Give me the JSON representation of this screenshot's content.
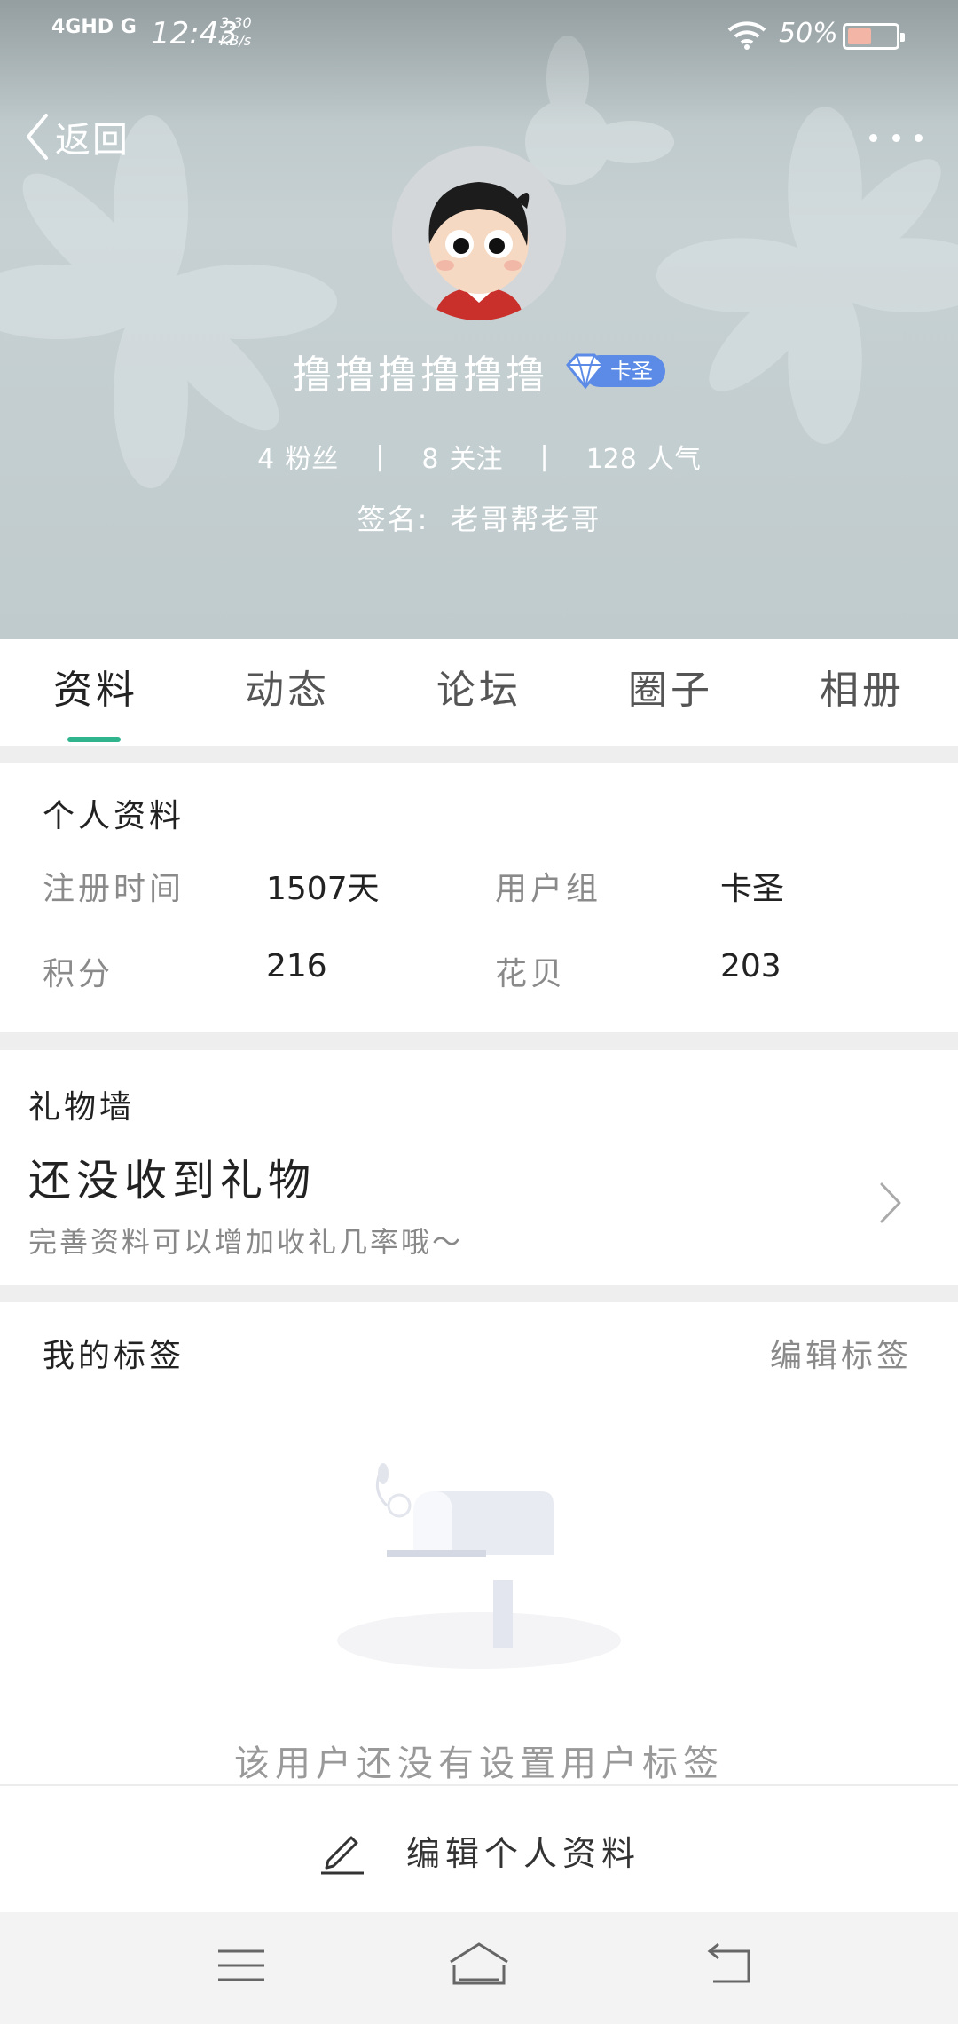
{
  "status_bar": {
    "network": "4GHD G",
    "time": "12:43",
    "speed_value": "3.30",
    "speed_unit": "KB/s",
    "battery_percent": "50%",
    "battery_level": 0.5
  },
  "header": {
    "back_label": "返回",
    "username": "撸撸撸撸撸撸",
    "badge_label": "卡圣",
    "fans_count": "4",
    "fans_label": "粉丝",
    "following_count": "8",
    "following_label": "关注",
    "popularity_count": "128",
    "popularity_label": "人气",
    "separator": "|",
    "signature_label": "签名:",
    "signature_value": "老哥帮老哥"
  },
  "tabs": [
    {
      "label": "资料",
      "active": true
    },
    {
      "label": "动态",
      "active": false
    },
    {
      "label": "论坛",
      "active": false
    },
    {
      "label": "圈子",
      "active": false
    },
    {
      "label": "相册",
      "active": false
    }
  ],
  "profile": {
    "title": "个人资料",
    "register_label": "注册时间",
    "register_value": "1507天",
    "group_label": "用户组",
    "group_value": "卡圣",
    "points_label": "积分",
    "points_value": "216",
    "huabei_label": "花贝",
    "huabei_value": "203"
  },
  "gift_wall": {
    "title": "礼物墙",
    "main": "还没收到礼物",
    "sub": "完善资料可以增加收礼几率哦～"
  },
  "tags": {
    "title": "我的标签",
    "edit_label": "编辑标签",
    "empty_text": "该用户还没有设置用户标签"
  },
  "edit_profile": {
    "label": "编辑个人资料"
  },
  "colors": {
    "accent": "#2fb48e",
    "badge": "#5b8be6"
  }
}
